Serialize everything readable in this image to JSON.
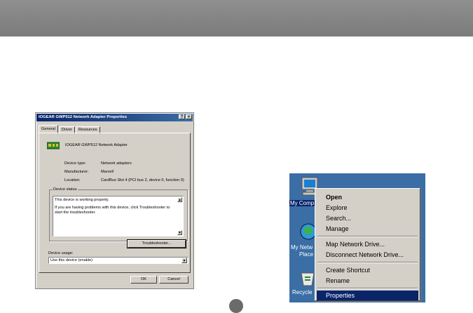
{
  "dialog": {
    "title": "IOGEAR GWP512 Network Adapter Properties",
    "help_button": "?",
    "close_button": "×",
    "tabs": [
      "General",
      "Driver",
      "Resources"
    ],
    "device_name": "IOGEAR GWP512 Network Adapter",
    "properties": [
      {
        "label": "Device type:",
        "value": "Network adapters"
      },
      {
        "label": "Manufacturer:",
        "value": "Marvell"
      },
      {
        "label": "Location:",
        "value": "CardBus Slot 4 (PCI bus 2, device 0, function 0)"
      }
    ],
    "device_status_label": "Device status",
    "status_lines": [
      "This device is working properly.",
      "If you are having problems with this device, click Troubleshooter to start the troubleshooter."
    ],
    "scroll_up": "▲",
    "scroll_down": "▼",
    "troubleshooter_button": "Troubleshooter...",
    "device_usage_label": "Device usage:",
    "device_usage_value": "Use this device (enable)",
    "dropdown_arrow": "▼",
    "ok_button": "OK",
    "cancel_button": "Cancel",
    "icon": "network-adapter-icon"
  },
  "desktop": {
    "icons": [
      {
        "name": "my-computer-icon",
        "label": "My Comp"
      },
      {
        "name": "my-network-places-icon",
        "label": "My Netw",
        "label2": "Place"
      },
      {
        "name": "recycle-bin-icon",
        "label": "Recycle"
      }
    ],
    "background_color": "#3a6ea5"
  },
  "context_menu": {
    "items": [
      "Open",
      "Explore",
      "Search...",
      "Manage",
      "Map Network Drive...",
      "Disconnect Network Drive...",
      "Create Shortcut",
      "Rename",
      "Properties"
    ],
    "highlighted": "Properties",
    "highlight_color": "#0a246a"
  }
}
